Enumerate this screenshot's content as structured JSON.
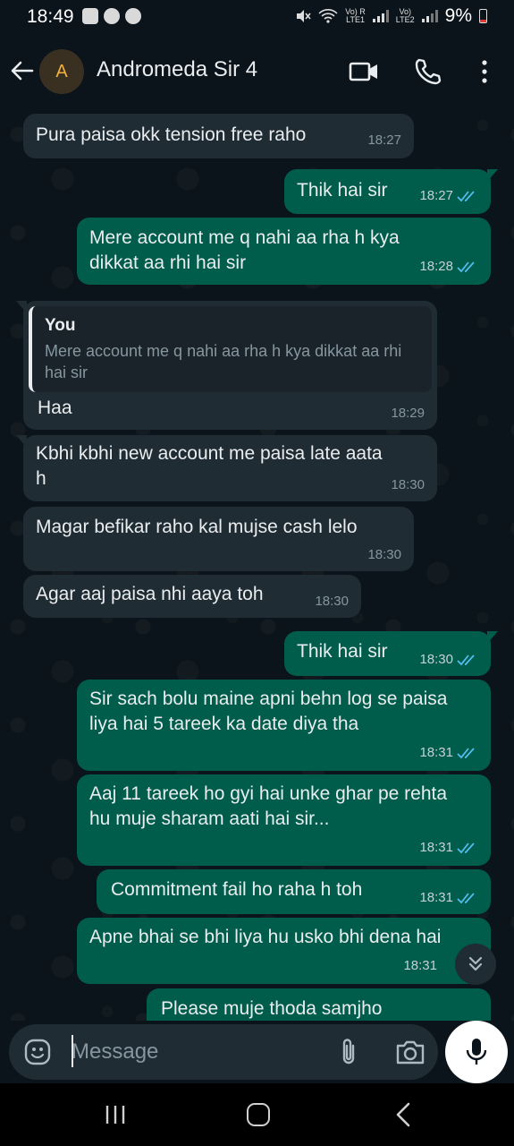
{
  "status_bar": {
    "time": "18:49",
    "sim1_label": "Vo) R\nLTE1",
    "sim2_label": "Vo)\nLTE2",
    "battery": "9%"
  },
  "header": {
    "avatar_letter": "A",
    "contact_name": "Andromeda Sir 4"
  },
  "messages": [
    {
      "dir": "in",
      "text": "Pura paisa okk tension free raho",
      "time": "18:27"
    },
    {
      "dir": "out",
      "text": "Thik hai sir",
      "time": "18:27"
    },
    {
      "dir": "out",
      "text": "Mere account me q nahi aa rha h kya dikkat aa rhi hai sir",
      "time": "18:28"
    },
    {
      "dir": "in",
      "quote_author": "You",
      "quote_text": "Mere account me q nahi aa rha h kya dikkat aa rhi hai sir",
      "text": "Haa",
      "time": "18:29"
    },
    {
      "dir": "in",
      "text": "Kbhi kbhi new account me paisa late aata h",
      "time": "18:30"
    },
    {
      "dir": "in",
      "text": "Magar befikar raho kal mujse cash lelo",
      "time": "18:30"
    },
    {
      "dir": "in",
      "text": "Agar aaj paisa nhi aaya toh",
      "time": "18:30"
    },
    {
      "dir": "out",
      "text": "Thik hai sir",
      "time": "18:30"
    },
    {
      "dir": "out",
      "text": "Sir sach bolu maine apni behn log se paisa liya hai 5 tareek ka date diya tha",
      "time": "18:31"
    },
    {
      "dir": "out",
      "text": "Aaj 11 tareek ho gyi hai unke ghar pe rehta hu muje sharam aati hai sir...",
      "time": "18:31"
    },
    {
      "dir": "out",
      "text": "Commitment fail ho raha h toh",
      "time": "18:31"
    },
    {
      "dir": "out",
      "text": "Apne bhai se bhi liya hu usko bhi dena hai",
      "time": "18:31"
    },
    {
      "dir": "out",
      "text": "Please muje thoda samjho",
      "time": ""
    }
  ],
  "composer": {
    "placeholder": "Message"
  },
  "colors": {
    "background": "#0b141a",
    "incoming_bubble": "#202c33",
    "outgoing_bubble": "#005c4b",
    "read_ticks": "#53bdeb",
    "avatar_letter": "#f0b03c"
  }
}
